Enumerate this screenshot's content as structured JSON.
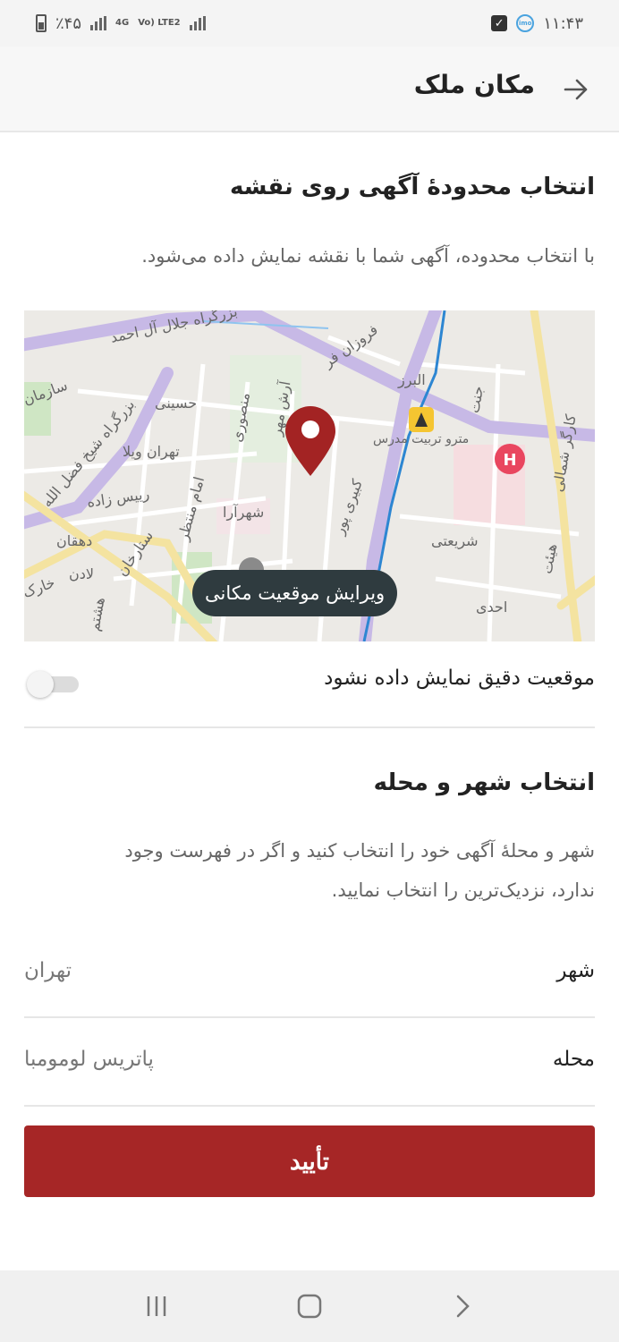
{
  "status_bar": {
    "battery_text": "٪۴۵",
    "network_4g": "4G",
    "network_volte": "Vo) LTE2",
    "time": "۱۱:۴۳",
    "icons": [
      "battery-icon",
      "signal-icon",
      "checkbox-notification-icon",
      "imo-icon"
    ]
  },
  "header": {
    "title": "مکان ملک",
    "back_icon": "arrow-right-icon"
  },
  "map_section": {
    "title": "انتخاب محدودهٔ آگهی روی نقشه",
    "description": "با انتخاب محدوده، آگهی شما با نقشه نمایش داده می‌شود.",
    "map_labels": {
      "l1": "بزرگراه جلال آل احمد",
      "l2": "سازمان",
      "l3": "بزرگراه شیخ فضل الله",
      "l4": "حسینی",
      "l5": "منصوری",
      "l6": "آرش مهر",
      "l7": "فروزان فر",
      "l8": "البرز",
      "l9": "مترو تربیت مدرس",
      "l10": "تهران ویلا",
      "l11": "رییس زاده",
      "l12": "امام منتظر",
      "l13": "شهرآرا",
      "l14": "کبیری پور",
      "l15": "شریعتی",
      "l16": "دهقان",
      "l17": "ستارخان",
      "l18": "لادن",
      "l19": "هشتم",
      "l20": "احدی",
      "l21": "کارگر شمالی",
      "l22": "هیئت",
      "l23": "جنت",
      "l24": "خارک"
    },
    "edit_button": "ویرایش موقعیت مکانی"
  },
  "exact_location": {
    "label": "موقعیت دقیق نمایش داده نشود",
    "enabled": false
  },
  "city_section": {
    "title": "انتخاب شهر و محله",
    "description_line1": "شهر و محلهٔ آگهی خود را انتخاب کنید و اگر در فهرست وجود",
    "description_line2": "ندارد، نزدیک‌ترین را انتخاب نمایید.",
    "city_label": "شهر",
    "city_value": "تهران",
    "district_label": "محله",
    "district_value": "پاتریس لومومبا"
  },
  "confirm_button": "تأیید",
  "colors": {
    "accent": "#a62626",
    "tooltip": "#2f3b3f",
    "pin": "#a32323"
  }
}
